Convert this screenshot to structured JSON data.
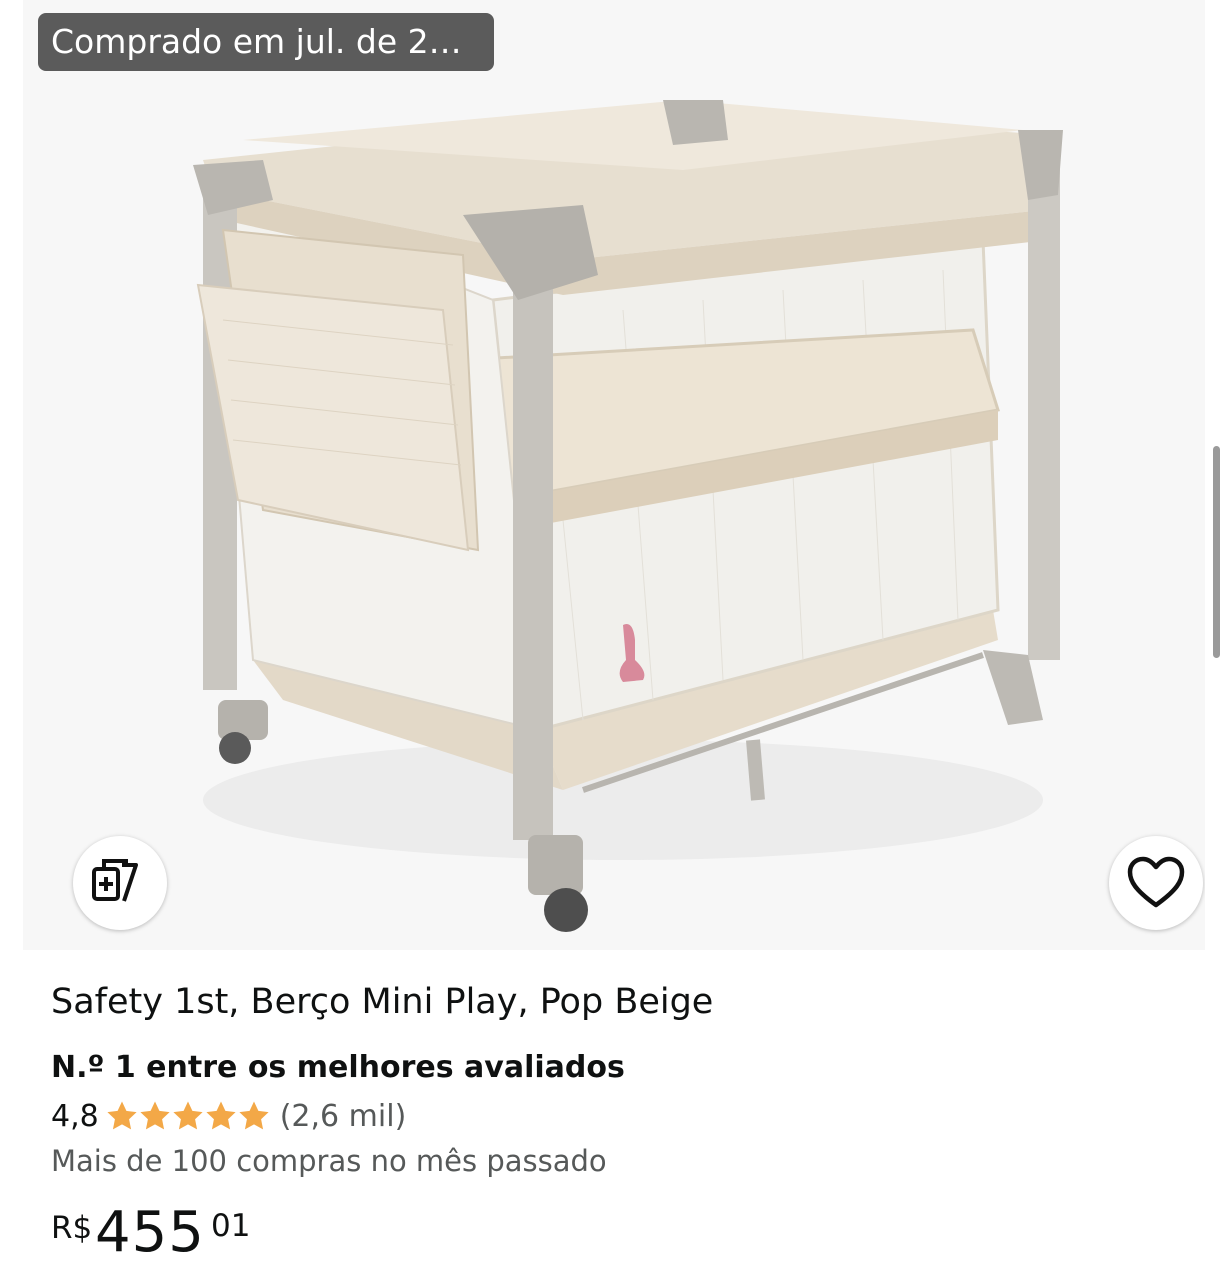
{
  "badge": {
    "purchased_text": "Comprado em jul. de 2…"
  },
  "product": {
    "title": "Safety 1st, Berço Mini Play, Pop Beige",
    "best_rated": "N.º 1 entre os melhores avaliados",
    "rating_value": "4,8",
    "rating_count": "(2,6 mil)",
    "stars": 5,
    "purchases": "Mais de 100 compras no mês passado",
    "price_symbol": "R$",
    "price_whole": "455",
    "price_fraction": "01"
  },
  "icons": {
    "compare": "compare-add-icon",
    "wishlist": "heart-icon",
    "star": "star-icon"
  },
  "colors": {
    "star": "#f3a847",
    "text": "#0f1111",
    "secondary_text": "#565959",
    "badge_bg": "#464646"
  }
}
